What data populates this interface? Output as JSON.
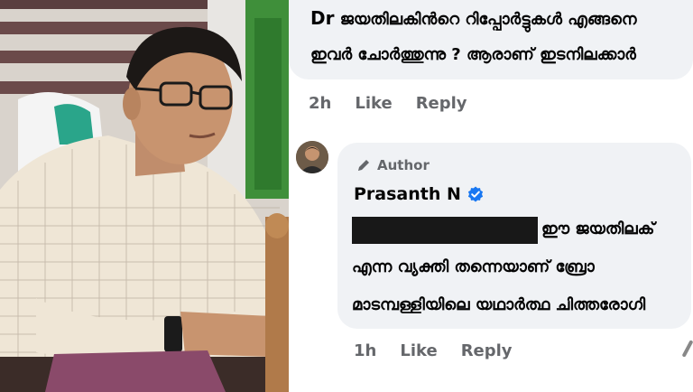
{
  "comment1": {
    "line1_prefix": "Dr",
    "line1_rest": "ജയതിലകിൻറെ റിപ്പോർട്ടുകൾ എങ്ങനെ",
    "line2": "ഇവർ ചോർത്തുന്നു ? ആരാണ് ഇടനിലക്കാർ",
    "time": "2h",
    "like_label": "Like",
    "reply_label": "Reply"
  },
  "reply": {
    "badge_label": "Author",
    "author_name": "Prasanth N",
    "line1": "ഈ ജയതിലക്",
    "line2": "എന്ന വ്യക്തി തന്നെയാണ് ബ്രോ",
    "line3": "മാടമ്പള്ളിയിലെ യഥാർത്ഥ ചിത്തരോഗി",
    "time": "1h",
    "like_label": "Like",
    "reply_label": "Reply"
  },
  "colors": {
    "bubble": "#f0f2f5",
    "meta_text": "#65676b",
    "verified": "#1877f2",
    "redaction": "#181818"
  },
  "icons": [
    "pen-icon",
    "verified-badge-icon"
  ]
}
